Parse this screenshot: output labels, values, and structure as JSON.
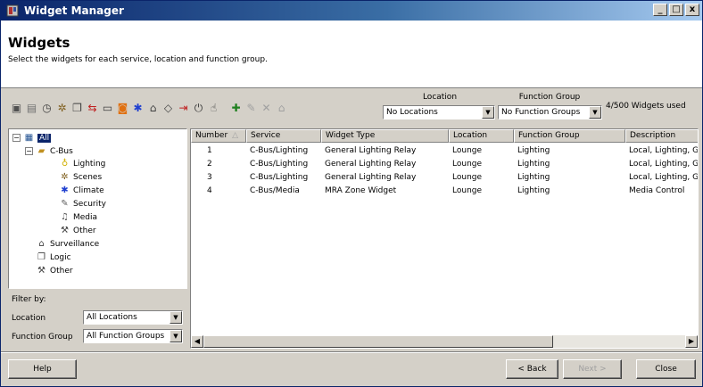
{
  "window": {
    "title": "Widget Manager",
    "controls": {
      "minimize": "_",
      "maximize": "□",
      "close": "x"
    }
  },
  "header": {
    "title": "Widgets",
    "subtitle": "Select the widgets for each service, location and function group."
  },
  "toolbar": {
    "icons": [
      "properties-icon",
      "save-icon",
      "timer-icon",
      "scenes-icon",
      "copy-icon",
      "transfer-icon",
      "display-icon",
      "rss-icon",
      "climate-icon",
      "surveillance-icon",
      "eraser-icon",
      "exit-icon",
      "power-icon",
      "hand-icon"
    ],
    "edit_icons": [
      "add-icon",
      "edit-icon",
      "delete-icon",
      "lock-icon"
    ],
    "location": {
      "label": "Location",
      "value": "No Locations"
    },
    "function_group": {
      "label": "Function Group",
      "value": "No Function Groups"
    },
    "widgets_used": "4/500 Widgets used"
  },
  "tree": {
    "all": "All",
    "cbus": "C-Bus",
    "children": [
      "Lighting",
      "Scenes",
      "Climate",
      "Security",
      "Media",
      "Other"
    ],
    "surveillance": "Surveillance",
    "logic": "Logic",
    "other": "Other"
  },
  "filter": {
    "title": "Filter by:",
    "location_label": "Location",
    "location_value": "All Locations",
    "function_group_label": "Function Group",
    "function_group_value": "All Function Groups"
  },
  "grid": {
    "columns": [
      "Number",
      "Service",
      "Widget Type",
      "Location",
      "Function Group",
      "Description"
    ],
    "rows": [
      [
        "1",
        "C-Bus/Lighting",
        "General Lighting Relay",
        "Lounge",
        "Lighting",
        "Local, Lighting, G"
      ],
      [
        "2",
        "C-Bus/Lighting",
        "General Lighting Relay",
        "Lounge",
        "Lighting",
        "Local, Lighting, G"
      ],
      [
        "3",
        "C-Bus/Lighting",
        "General Lighting Relay",
        "Lounge",
        "Lighting",
        "Local, Lighting, G"
      ],
      [
        "4",
        "C-Bus/Media",
        "MRA Zone Widget",
        "Lounge",
        "Lighting",
        "Media Control"
      ]
    ]
  },
  "buttons": {
    "help": "Help",
    "back": "< Back",
    "next": "Next >",
    "close": "Close"
  }
}
